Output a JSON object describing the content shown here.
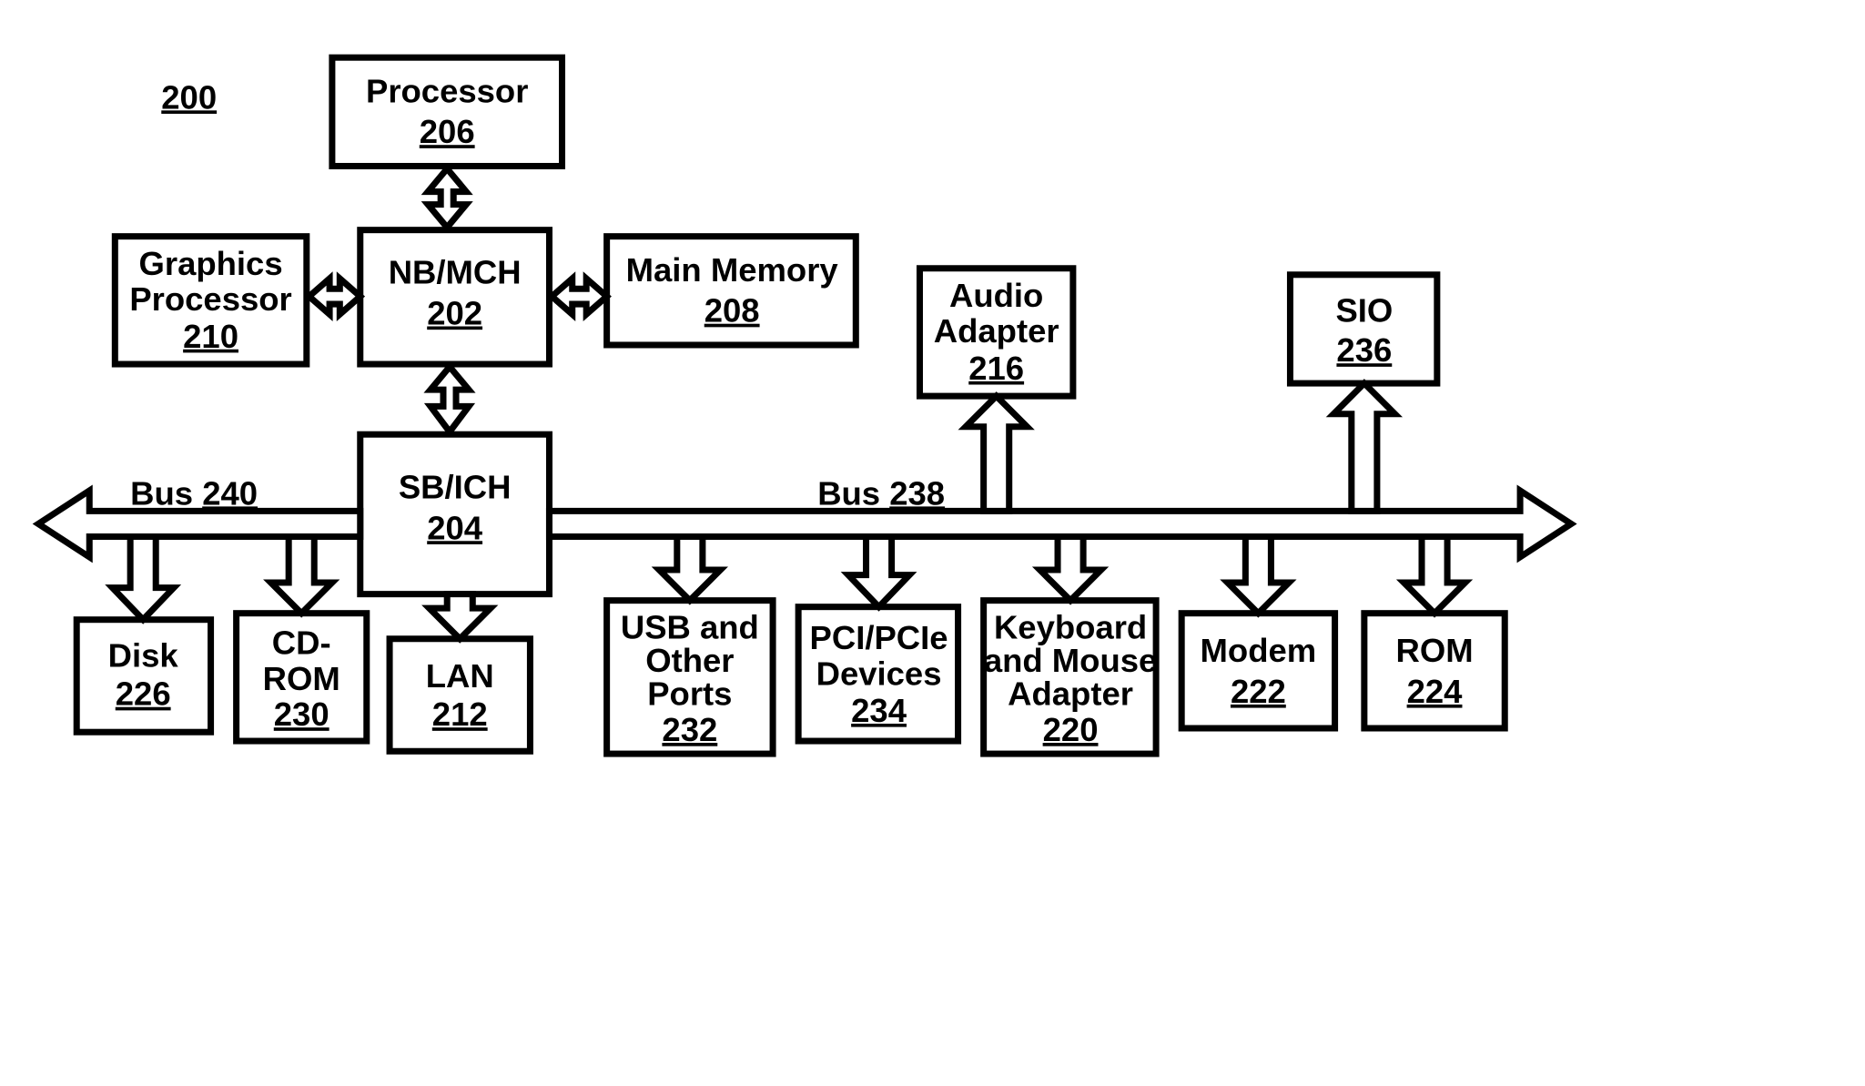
{
  "figure": {
    "id": "200"
  },
  "blocks": {
    "processor": {
      "label": "Processor",
      "ref": "206"
    },
    "nbmch": {
      "label": "NB/MCH",
      "ref": "202"
    },
    "graphics": {
      "label": "Graphics Processor",
      "ref": "210"
    },
    "mainmem": {
      "label": "Main Memory",
      "ref": "208"
    },
    "sbich": {
      "label": "SB/ICH",
      "ref": "204"
    },
    "audio": {
      "label": "Audio Adapter",
      "ref": "216"
    },
    "sio": {
      "label": "SIO",
      "ref": "236"
    },
    "disk": {
      "label": "Disk",
      "ref": "226"
    },
    "cdrom": {
      "label": "CD-ROM",
      "ref": "230"
    },
    "lan": {
      "label": "LAN",
      "ref": "212"
    },
    "usb": {
      "label": "USB and Other Ports",
      "ref": "232"
    },
    "pci": {
      "label": "PCI/PCIe Devices",
      "ref": "234"
    },
    "kbd": {
      "label": "Keyboard and Mouse Adapter",
      "ref": "220"
    },
    "modem": {
      "label": "Modem",
      "ref": "222"
    },
    "rom": {
      "label": "ROM",
      "ref": "224"
    }
  },
  "buses": {
    "left": {
      "label": "Bus",
      "ref": "240"
    },
    "right": {
      "label": "Bus",
      "ref": "238"
    }
  }
}
